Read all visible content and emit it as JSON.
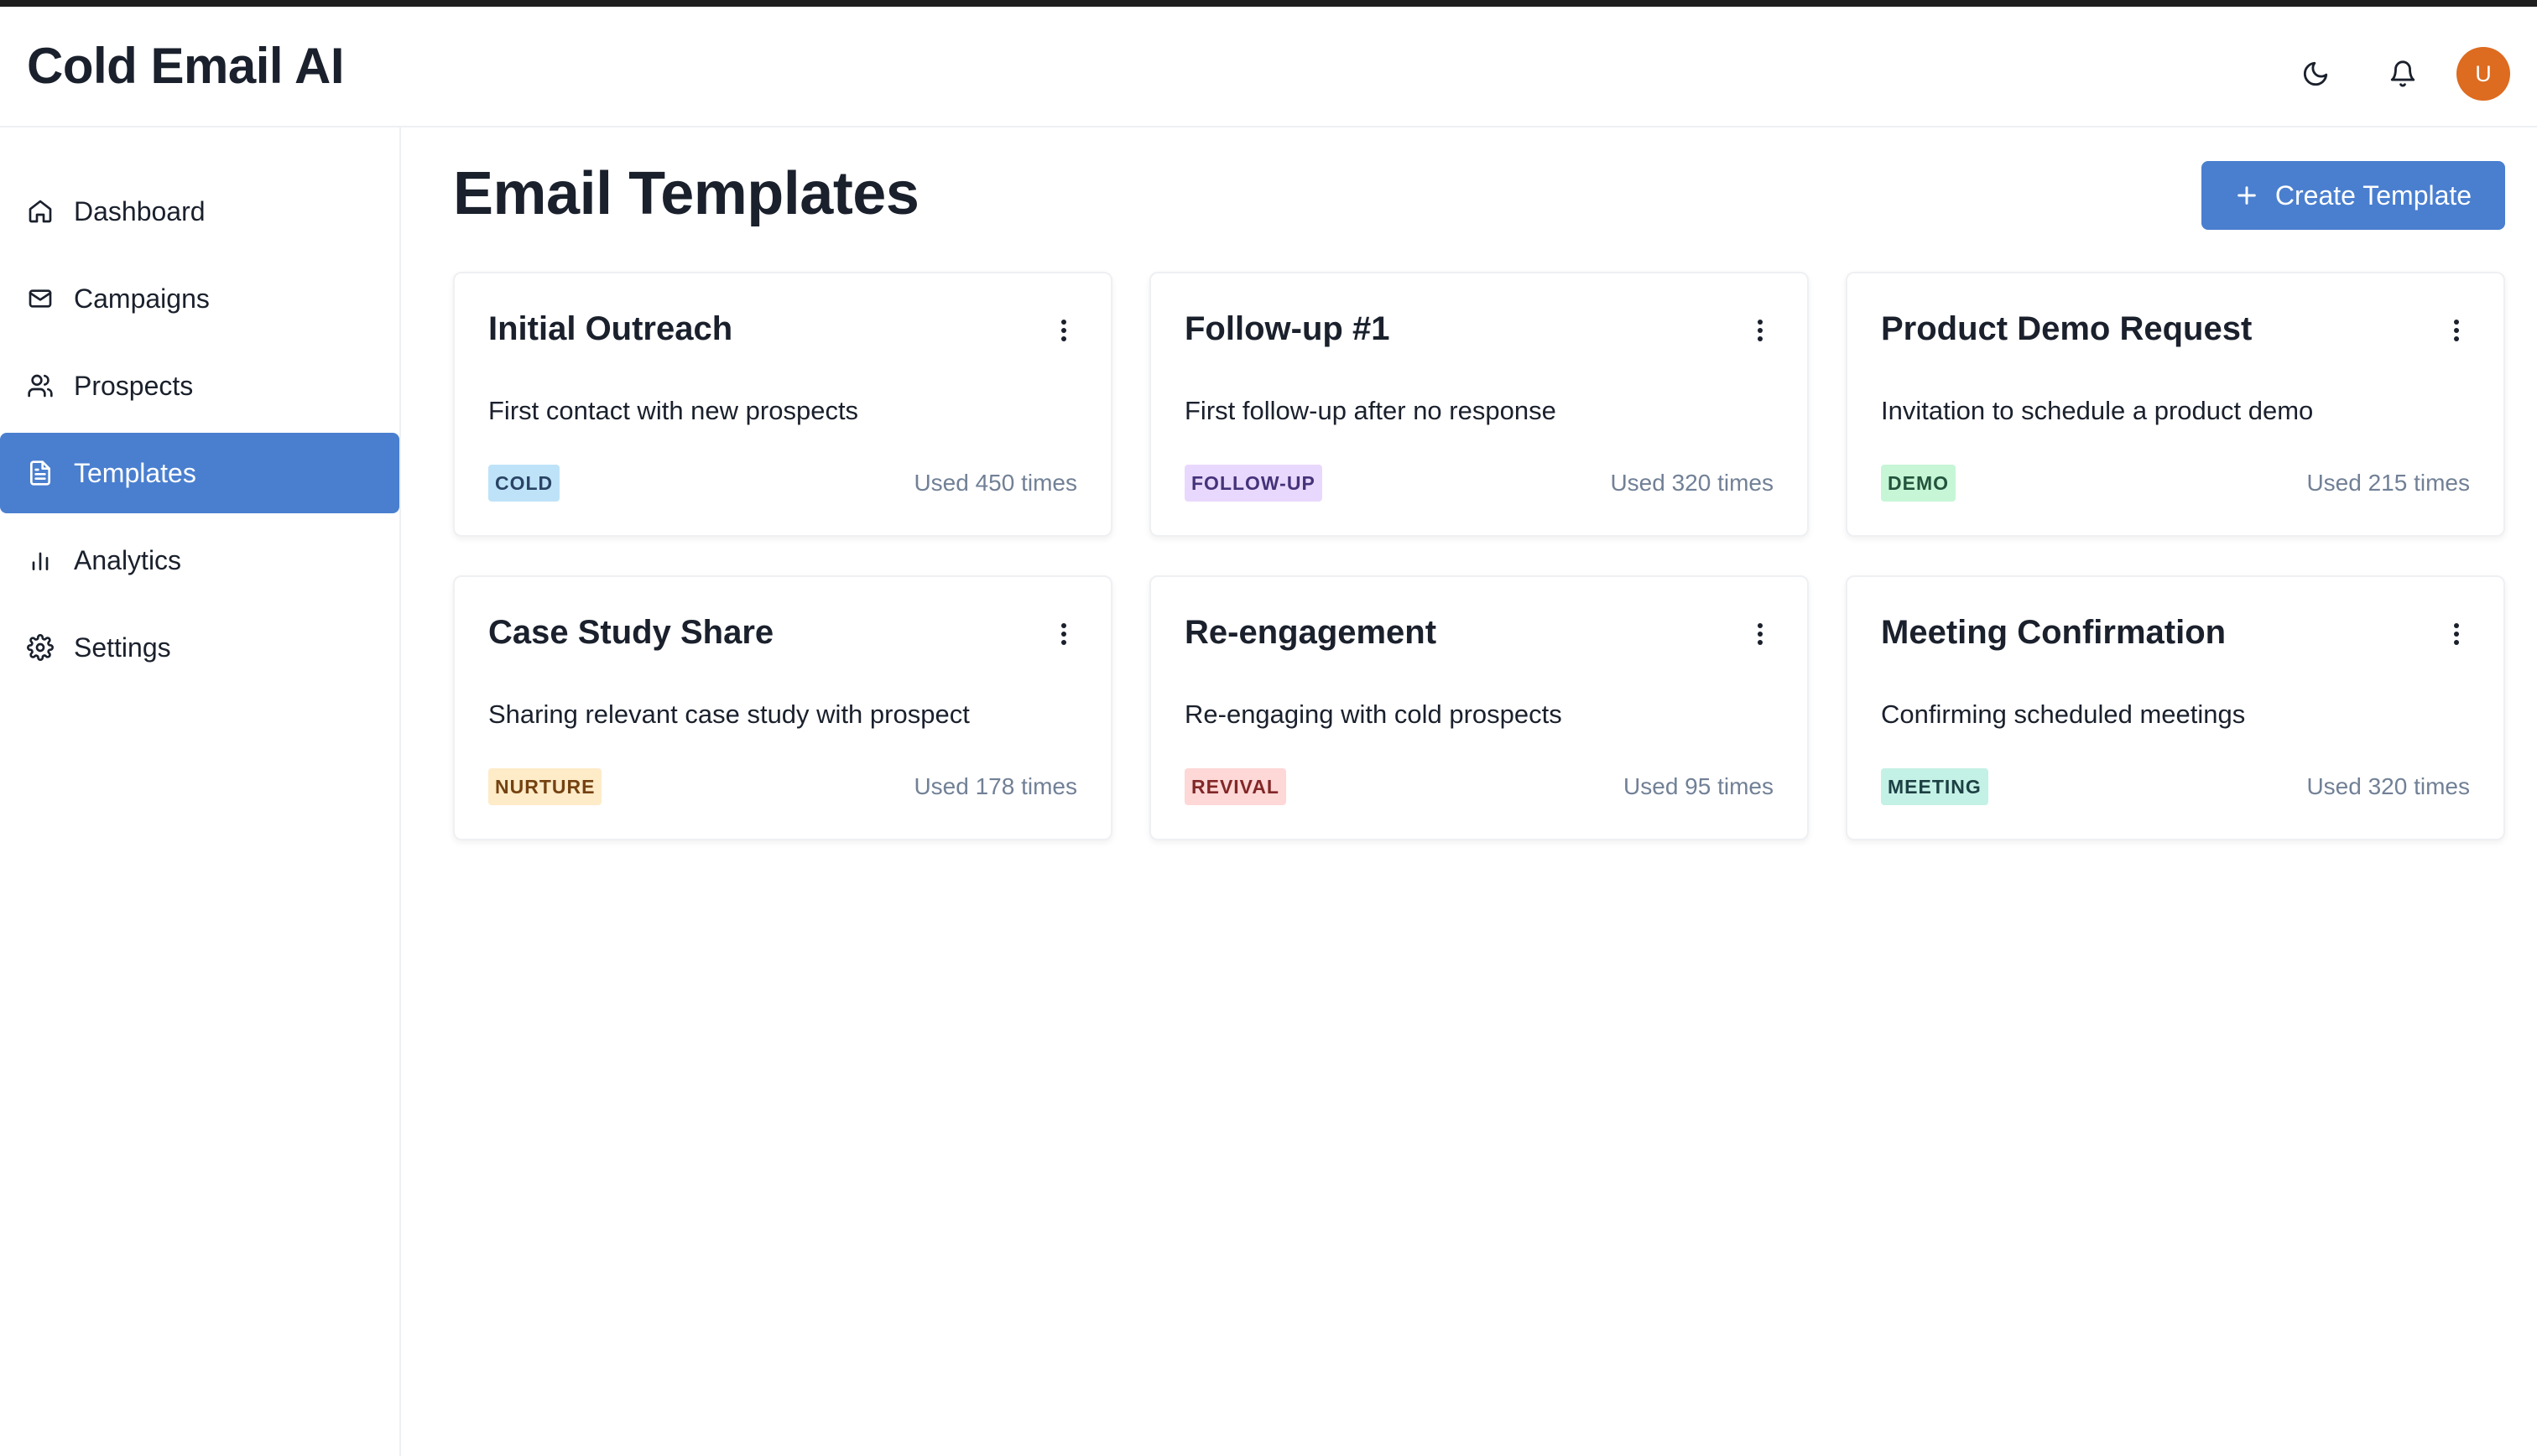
{
  "app": {
    "title": "Cold Email AI"
  },
  "header": {
    "theme_icon": "moon-icon",
    "notification_icon": "bell-icon",
    "avatar_initial": "U"
  },
  "sidebar": {
    "items": [
      {
        "label": "Dashboard",
        "icon": "home-icon",
        "active": false
      },
      {
        "label": "Campaigns",
        "icon": "mail-icon",
        "active": false
      },
      {
        "label": "Prospects",
        "icon": "users-icon",
        "active": false
      },
      {
        "label": "Templates",
        "icon": "file-text-icon",
        "active": true
      },
      {
        "label": "Analytics",
        "icon": "bar-chart-icon",
        "active": false
      },
      {
        "label": "Settings",
        "icon": "gear-icon",
        "active": false
      }
    ]
  },
  "main": {
    "title": "Email Templates",
    "create_button_label": "Create Template",
    "templates": [
      {
        "title": "Initial Outreach",
        "description": "First contact with new prospects",
        "tag": "COLD",
        "usage": "Used 450 times",
        "tag_bg": "#bee3f8",
        "tag_fg": "#2a4365"
      },
      {
        "title": "Follow-up #1",
        "description": "First follow-up after no response",
        "tag": "FOLLOW-UP",
        "usage": "Used 320 times",
        "tag_bg": "#e9d8fd",
        "tag_fg": "#44337a"
      },
      {
        "title": "Product Demo Request",
        "description": "Invitation to schedule a product demo",
        "tag": "DEMO",
        "usage": "Used 215 times",
        "tag_bg": "#c6f6d5",
        "tag_fg": "#22543d"
      },
      {
        "title": "Case Study Share",
        "description": "Sharing relevant case study with prospect",
        "tag": "NURTURE",
        "usage": "Used 178 times",
        "tag_bg": "#feebc8",
        "tag_fg": "#744210"
      },
      {
        "title": "Re-engagement",
        "description": "Re-engaging with cold prospects",
        "tag": "REVIVAL",
        "usage": "Used 95 times",
        "tag_bg": "#fed7d7",
        "tag_fg": "#822727"
      },
      {
        "title": "Meeting Confirmation",
        "description": "Confirming scheduled meetings",
        "tag": "MEETING",
        "usage": "Used 320 times",
        "tag_bg": "#c4f1e5",
        "tag_fg": "#1d4044"
      }
    ]
  },
  "colors": {
    "accent": "#4a7fcf",
    "avatar": "#dd6b20",
    "muted_text": "#718096"
  }
}
